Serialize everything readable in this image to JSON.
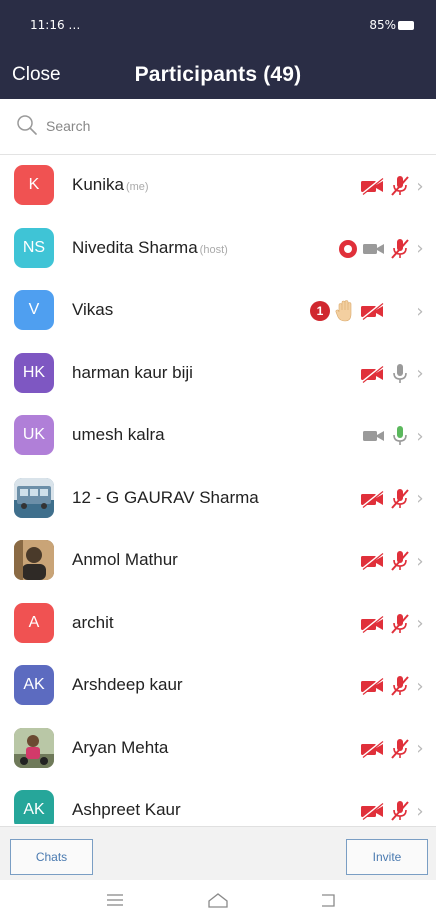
{
  "status_bar": {
    "time": "11:16",
    "left_extra": "…",
    "right_text": "85%"
  },
  "header": {
    "close_label": "Close",
    "title": "Participants (49)"
  },
  "search": {
    "placeholder": "Search"
  },
  "colors": {
    "header_bg": "#2a2d45",
    "muted_red": "#e0303a",
    "mic_on_green": "#5bb85d",
    "mic_off_gray": "#9a9a9a",
    "accent_blue": "#4a7ab0"
  },
  "participants": [
    {
      "name": "Kunika",
      "tag": "(me)",
      "initials": "K",
      "avatar_color": "#f05252"
    },
    {
      "name": "Nivedita Sharma",
      "tag": "(host)",
      "initials": "NS",
      "avatar_color": "#3fc4d6"
    },
    {
      "name": "Vikas",
      "tag": "",
      "initials": "V",
      "avatar_color": "#4f9ff0",
      "hand_count": "1"
    },
    {
      "name": "harman kaur biji",
      "tag": "",
      "initials": "HK",
      "avatar_color": "#7e57c2"
    },
    {
      "name": "umesh kalra",
      "tag": "",
      "initials": "UK",
      "avatar_color": "#b07fd8"
    },
    {
      "name": "12 - G GAURAV Sharma",
      "tag": "",
      "initials": "",
      "avatar_color": "#6c8fa8"
    },
    {
      "name": "Anmol Mathur",
      "tag": "",
      "initials": "",
      "avatar_color": "#7a6248"
    },
    {
      "name": "archit",
      "tag": "",
      "initials": "A",
      "avatar_color": "#f05252"
    },
    {
      "name": "Arshdeep kaur",
      "tag": "",
      "initials": "AK",
      "avatar_color": "#5c6bc0"
    },
    {
      "name": "Aryan Mehta",
      "tag": "",
      "initials": "",
      "avatar_color": "#9a8f78"
    },
    {
      "name": "Ashpreet Kaur",
      "tag": "",
      "initials": "AK",
      "avatar_color": "#26a69a"
    }
  ],
  "bottom": {
    "chats_label": "Chats",
    "invite_label": "Invite"
  }
}
